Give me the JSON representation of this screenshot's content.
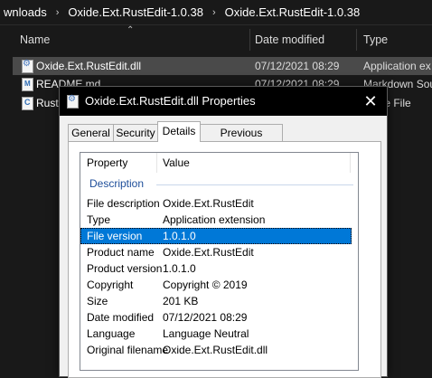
{
  "explorer": {
    "breadcrumb": [
      "wnloads",
      "Oxide.Ext.RustEdit-1.0.38",
      "Oxide.Ext.RustEdit-1.0.38"
    ],
    "columns": {
      "name": "Name",
      "date": "Date modified",
      "type": "Type"
    },
    "files": [
      {
        "name": "Oxide.Ext.RustEdit.dll",
        "date": "07/12/2021 08:29",
        "type": "Application ex",
        "icon": "dll-file-icon"
      },
      {
        "name": "README.md",
        "date": "07/12/2021 08:29",
        "type": "Markdown Sou",
        "icon": "markdown-file-icon"
      },
      {
        "name": "Rust",
        "date": "",
        "type": "ource File",
        "icon": "csharp-file-icon"
      }
    ]
  },
  "dialog": {
    "title": "Oxide.Ext.RustEdit.dll Properties",
    "close_glyph": "✕",
    "tabs": [
      "General",
      "Security",
      "Details",
      "Previous Versions"
    ],
    "active_tab": "Details",
    "list": {
      "header": {
        "property": "Property",
        "value": "Value"
      },
      "group": "Description",
      "rows": [
        {
          "k": "File description",
          "v": "Oxide.Ext.RustEdit"
        },
        {
          "k": "Type",
          "v": "Application extension"
        },
        {
          "k": "File version",
          "v": "1.0.1.0"
        },
        {
          "k": "Product name",
          "v": "Oxide.Ext.RustEdit"
        },
        {
          "k": "Product version",
          "v": "1.0.1.0"
        },
        {
          "k": "Copyright",
          "v": "Copyright © 2019"
        },
        {
          "k": "Size",
          "v": "201 KB"
        },
        {
          "k": "Date modified",
          "v": "07/12/2021 08:29"
        },
        {
          "k": "Language",
          "v": "Language Neutral"
        },
        {
          "k": "Original filename",
          "v": "Oxide.Ext.RustEdit.dll"
        }
      ],
      "selected_row": "File version"
    }
  },
  "colors": {
    "selection": "#0078d7",
    "group_title": "#1e4e9a",
    "explorer_bg": "#191919"
  }
}
